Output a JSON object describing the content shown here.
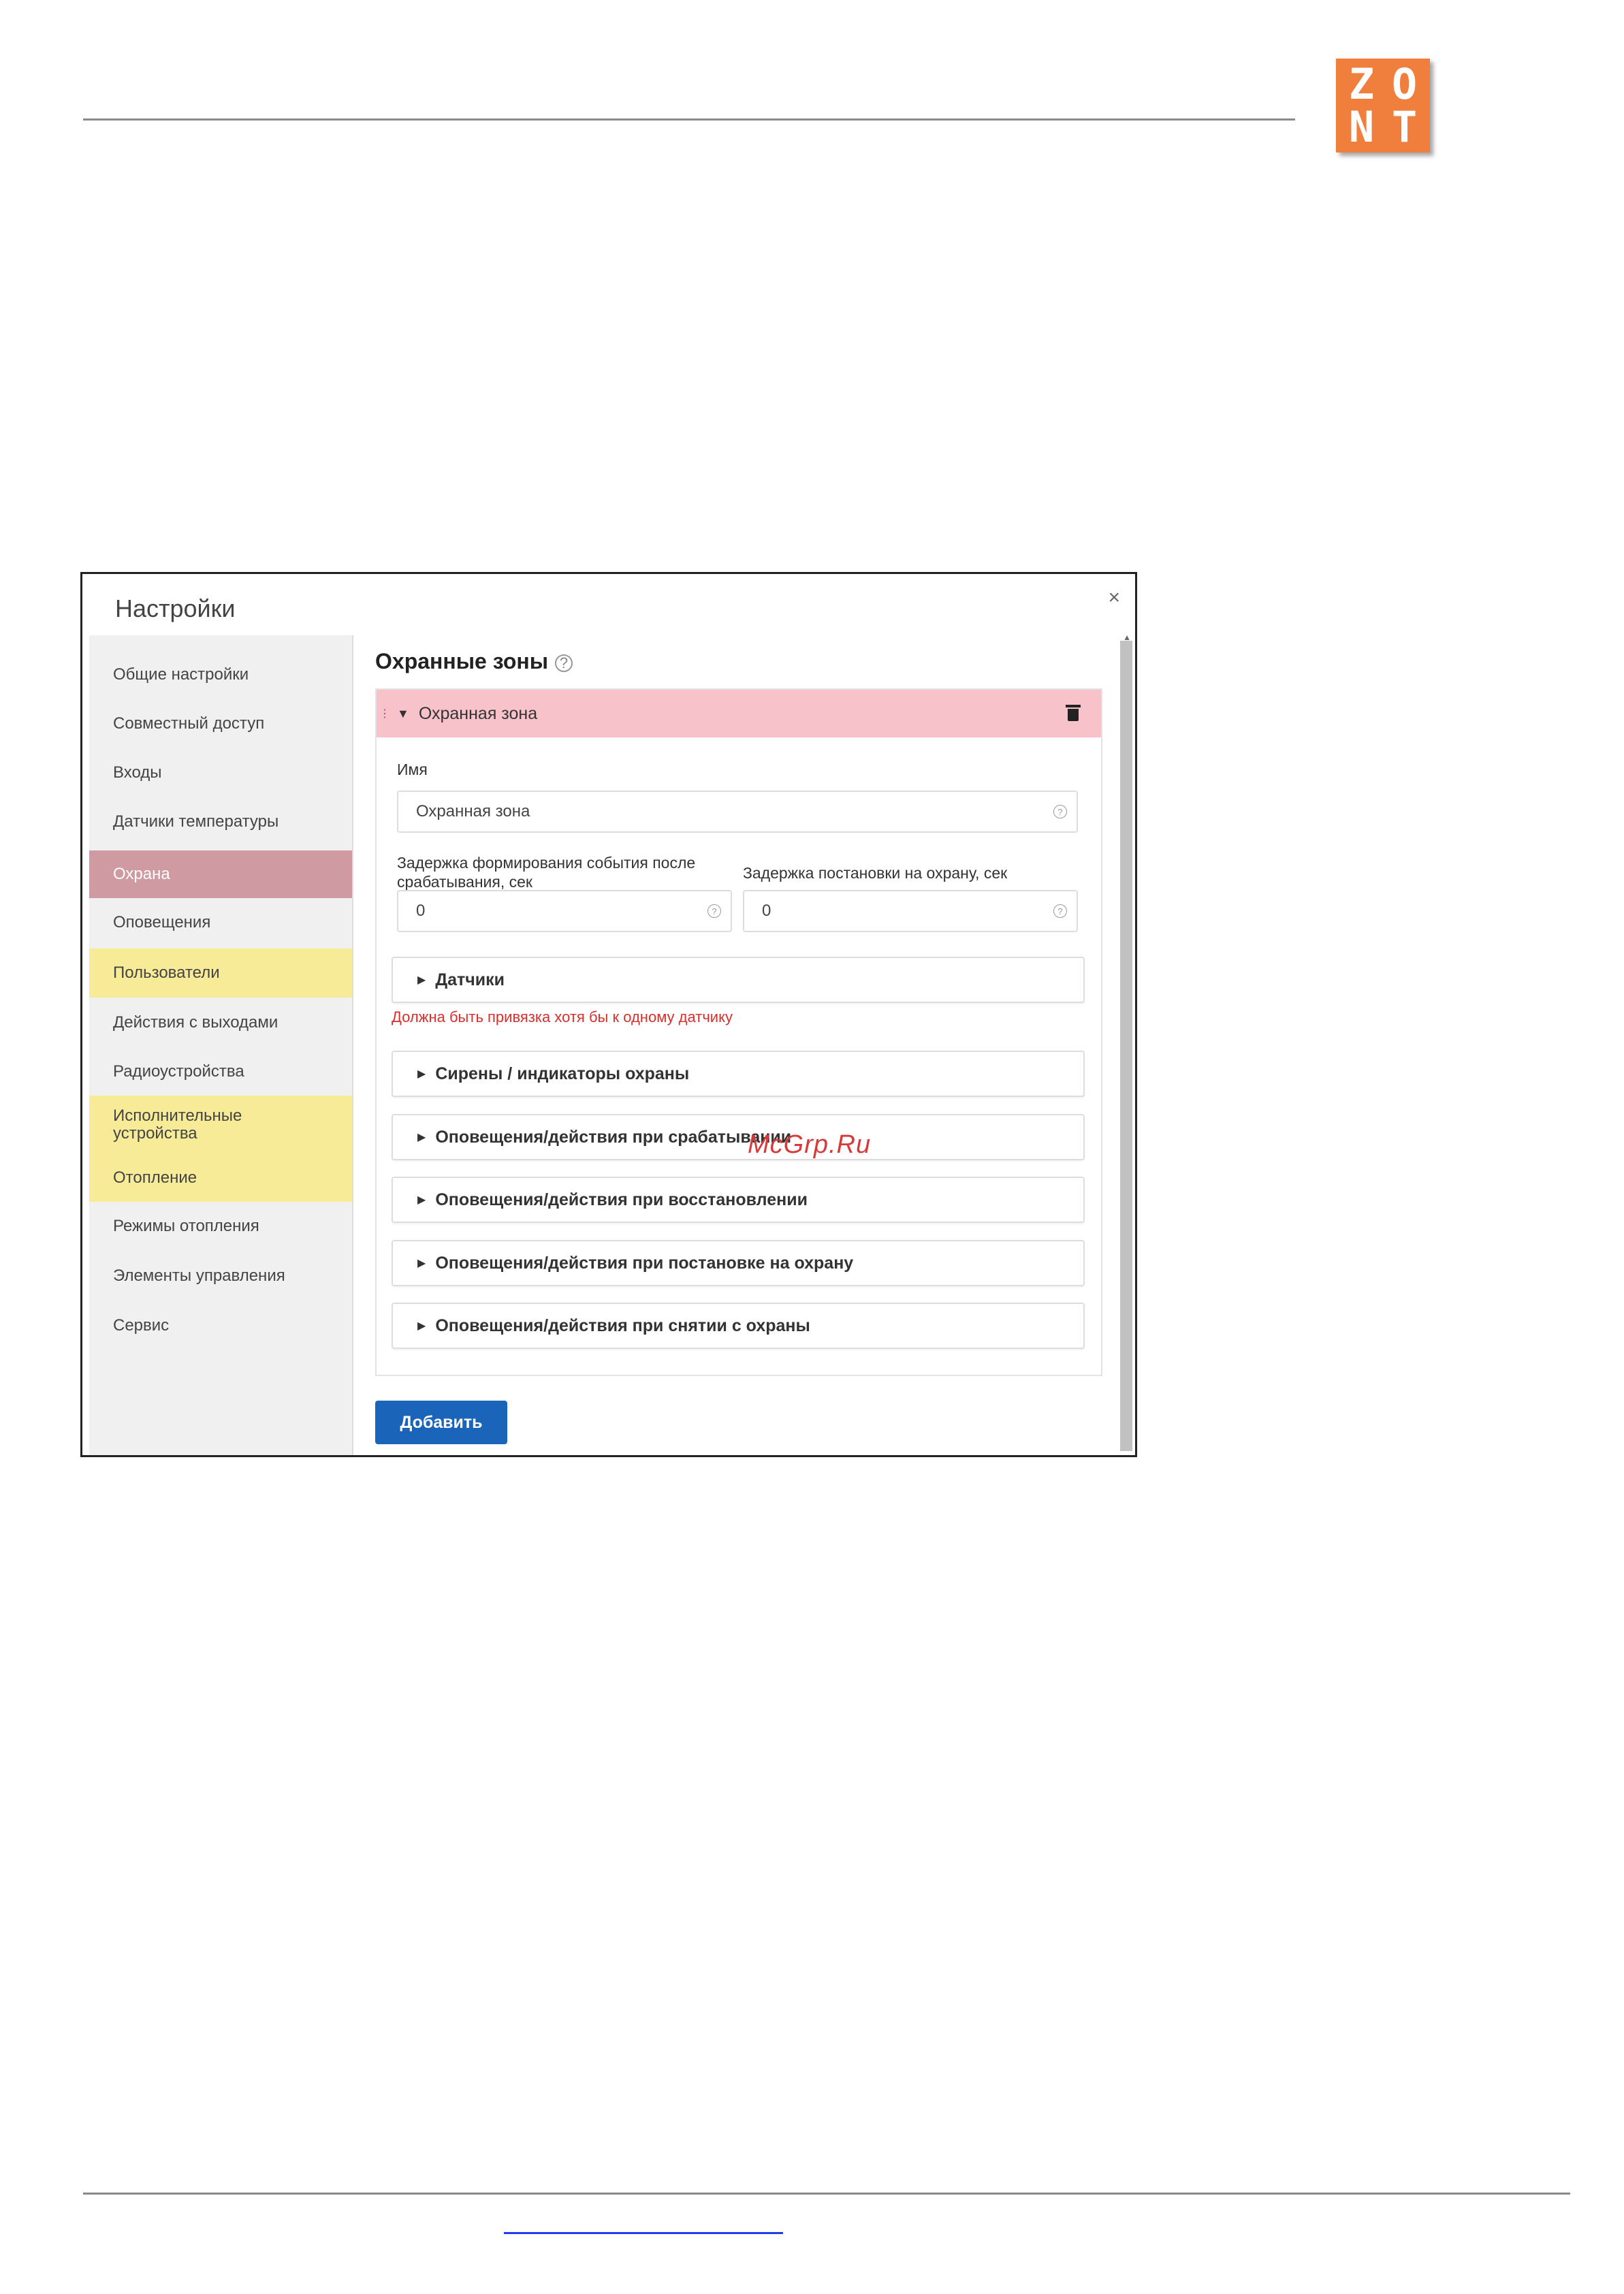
{
  "logo": {
    "letters": [
      "Z",
      "O",
      "N",
      "T"
    ],
    "color": "#f07e3c"
  },
  "modal": {
    "title": "Настройки",
    "close_label": "×"
  },
  "sidebar": {
    "items": [
      {
        "label": "Общие настройки",
        "state": "normal"
      },
      {
        "label": "Совместный доступ",
        "state": "normal"
      },
      {
        "label": "Входы",
        "state": "normal"
      },
      {
        "label": "Датчики температуры",
        "state": "normal"
      },
      {
        "label": "Охрана",
        "state": "active"
      },
      {
        "label": "Оповещения",
        "state": "normal"
      },
      {
        "label": "Пользователи",
        "state": "highlight"
      },
      {
        "label": "Действия с выходами",
        "state": "normal"
      },
      {
        "label": "Радиоустройства",
        "state": "normal"
      },
      {
        "label_line1": "Исполнительные",
        "label_line2": "устройства",
        "state": "highlight"
      },
      {
        "label": "Отопление",
        "state": "highlight"
      },
      {
        "label": "Режимы отопления",
        "state": "normal"
      },
      {
        "label": "Элементы управления",
        "state": "normal"
      },
      {
        "label": "Сервис",
        "state": "normal"
      }
    ]
  },
  "main": {
    "section_title": "Охранные зоны",
    "zone": {
      "title": "Охранная зона",
      "name_label": "Имя",
      "name_value": "Охранная зона",
      "delay_event_label_line1": "Задержка формирования события после",
      "delay_event_label_line2": "срабатывания, сек",
      "delay_event_value": "0",
      "delay_arm_label": "Задержка постановки на охрану, сек",
      "delay_arm_value": "0",
      "sensors_label": "Датчики",
      "sensors_error": "Должна быть привязка хотя бы к одному датчику",
      "sections": [
        "Сирены / индикаторы охраны",
        "Оповещения/действия при срабатывании",
        "Оповещения/действия при восстановлении",
        "Оповещения/действия при постановке на охрану",
        "Оповещения/действия при снятии с охраны"
      ]
    },
    "add_button": "Добавить"
  },
  "watermark": "McGrp.Ru",
  "colors": {
    "active_item": "#cf9aa1",
    "highlight_item": "#f7eb98",
    "zone_header": "#f8c2cb",
    "primary_button": "#1a64ba",
    "error": "#d9302c"
  }
}
